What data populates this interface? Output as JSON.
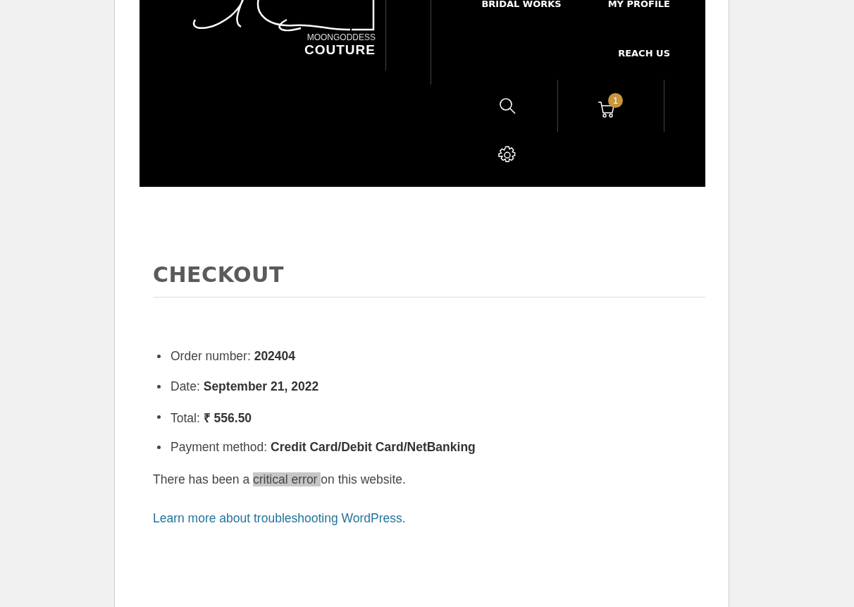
{
  "header": {
    "brand": {
      "line1": "MOONGODDESS",
      "line2": "COUTURE"
    },
    "nav": [
      {
        "label": "BRIDAL WORKS"
      },
      {
        "label": "MY PROFILE"
      },
      {
        "label": "REACH US"
      }
    ],
    "cart": {
      "count": "1"
    }
  },
  "page": {
    "title": "CHECKOUT",
    "order_details": [
      "Order number: **202404**",
      "Date: **September 21, 2022**",
      "Total: **₹ 556.50**",
      "Payment method: **Credit Card/Debit Card/NetBanking**"
    ],
    "error_message": {
      "before": "There has been a ",
      "highlighted": "critical error ",
      "after": "on this website."
    },
    "help_link": "Learn more about troubleshooting WordPress."
  }
}
